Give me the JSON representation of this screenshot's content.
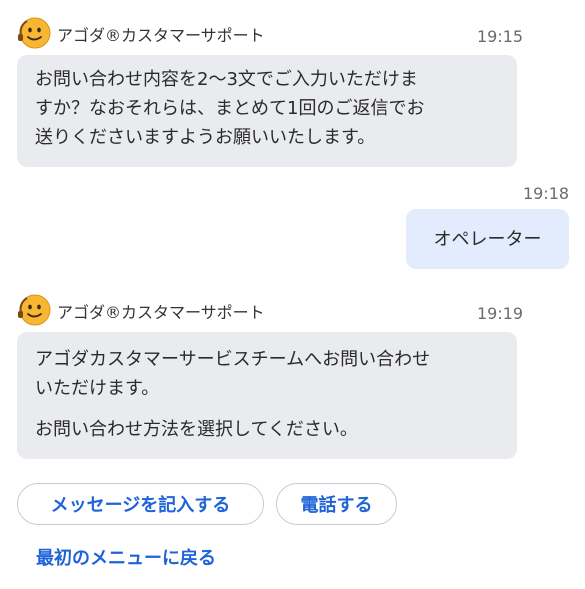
{
  "colors": {
    "bot_bubble": "#e9ebef",
    "user_bubble": "#e2ecfc",
    "link_blue": "#1f63d8",
    "avatar_yellow": "#f7b733"
  },
  "messages": [
    {
      "sender": "アゴダ®カスタマーサポート",
      "avatar_icon": "smiling-face-headset-icon",
      "time": "19:15",
      "lines": [
        "お問い合わせ内容を2〜3文でご入力いただけま",
        "すか？なおそれらは、まとめて1回のご返信でお",
        "送りくださいますようお願いいたします。"
      ]
    },
    {
      "sender": "user",
      "time": "19:18",
      "text": "オペレーター"
    },
    {
      "sender": "アゴダ®カスタマーサポート",
      "avatar_icon": "smiling-face-headset-icon",
      "time": "19:19",
      "paragraph1": [
        "アゴダカスタマーサービスチームへお問い合わせ",
        "いただけます。"
      ],
      "paragraph2": "お問い合わせ方法を選択してください。"
    }
  ],
  "quick_replies": {
    "message": "メッセージを記入する",
    "phone": "電話する",
    "back": "最初のメニューに戻る"
  }
}
